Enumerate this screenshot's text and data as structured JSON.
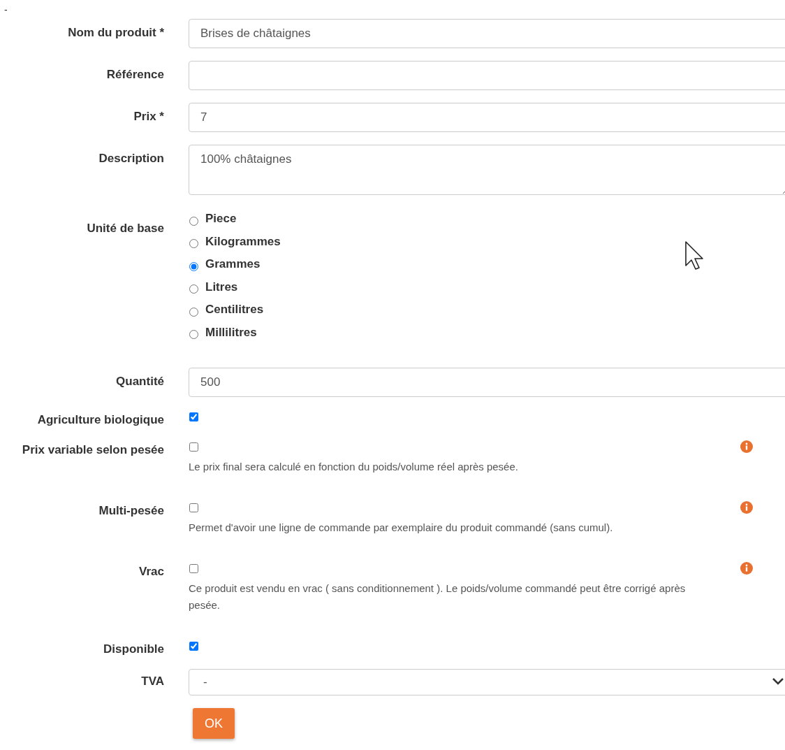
{
  "top_mark": "-",
  "fields": [
    {
      "kind": "text",
      "label": "Nom du produit *",
      "value": "Brises de châtaignes"
    },
    {
      "kind": "text",
      "label": "Référence"
    },
    {
      "kind": "text",
      "label": "Prix *",
      "value": "7"
    },
    {
      "kind": "textarea",
      "label": "Description",
      "value": "100% châtaignes"
    },
    {
      "kind": "radio",
      "label": "Unité de base",
      "options": [
        {
          "label": "Piece",
          "selected": false
        },
        {
          "label": "Kilogrammes",
          "selected": false
        },
        {
          "label": "Grammes",
          "selected": true
        },
        {
          "label": "Litres",
          "selected": false
        },
        {
          "label": "Centilitres",
          "selected": false
        },
        {
          "label": "Millilitres",
          "selected": false
        }
      ]
    },
    {
      "kind": "text",
      "label": "Quantité",
      "value": "500"
    },
    {
      "kind": "checkbox",
      "label": "Agriculture biologique",
      "checked": true
    },
    {
      "kind": "checkbox",
      "label": "Prix variable selon pesée",
      "checked": false,
      "info": true,
      "help": "Le prix final sera calculé en fonction du poids/volume réel après pesée."
    },
    {
      "kind": "checkbox",
      "label": "Multi-pesée",
      "checked": false,
      "info": true,
      "help": "Permet d'avoir une ligne de commande par exemplaire du produit commandé (sans cumul)."
    },
    {
      "kind": "checkbox",
      "label": "Vrac",
      "checked": false,
      "info": true,
      "help": "Ce produit est vendu en vrac ( sans conditionnement ). Le poids/volume commandé peut être corrigé après pesée."
    },
    {
      "kind": "checkbox",
      "label": "Disponible",
      "checked": true
    },
    {
      "kind": "select",
      "label": "TVA",
      "value": "-"
    }
  ],
  "submit": "OK"
}
